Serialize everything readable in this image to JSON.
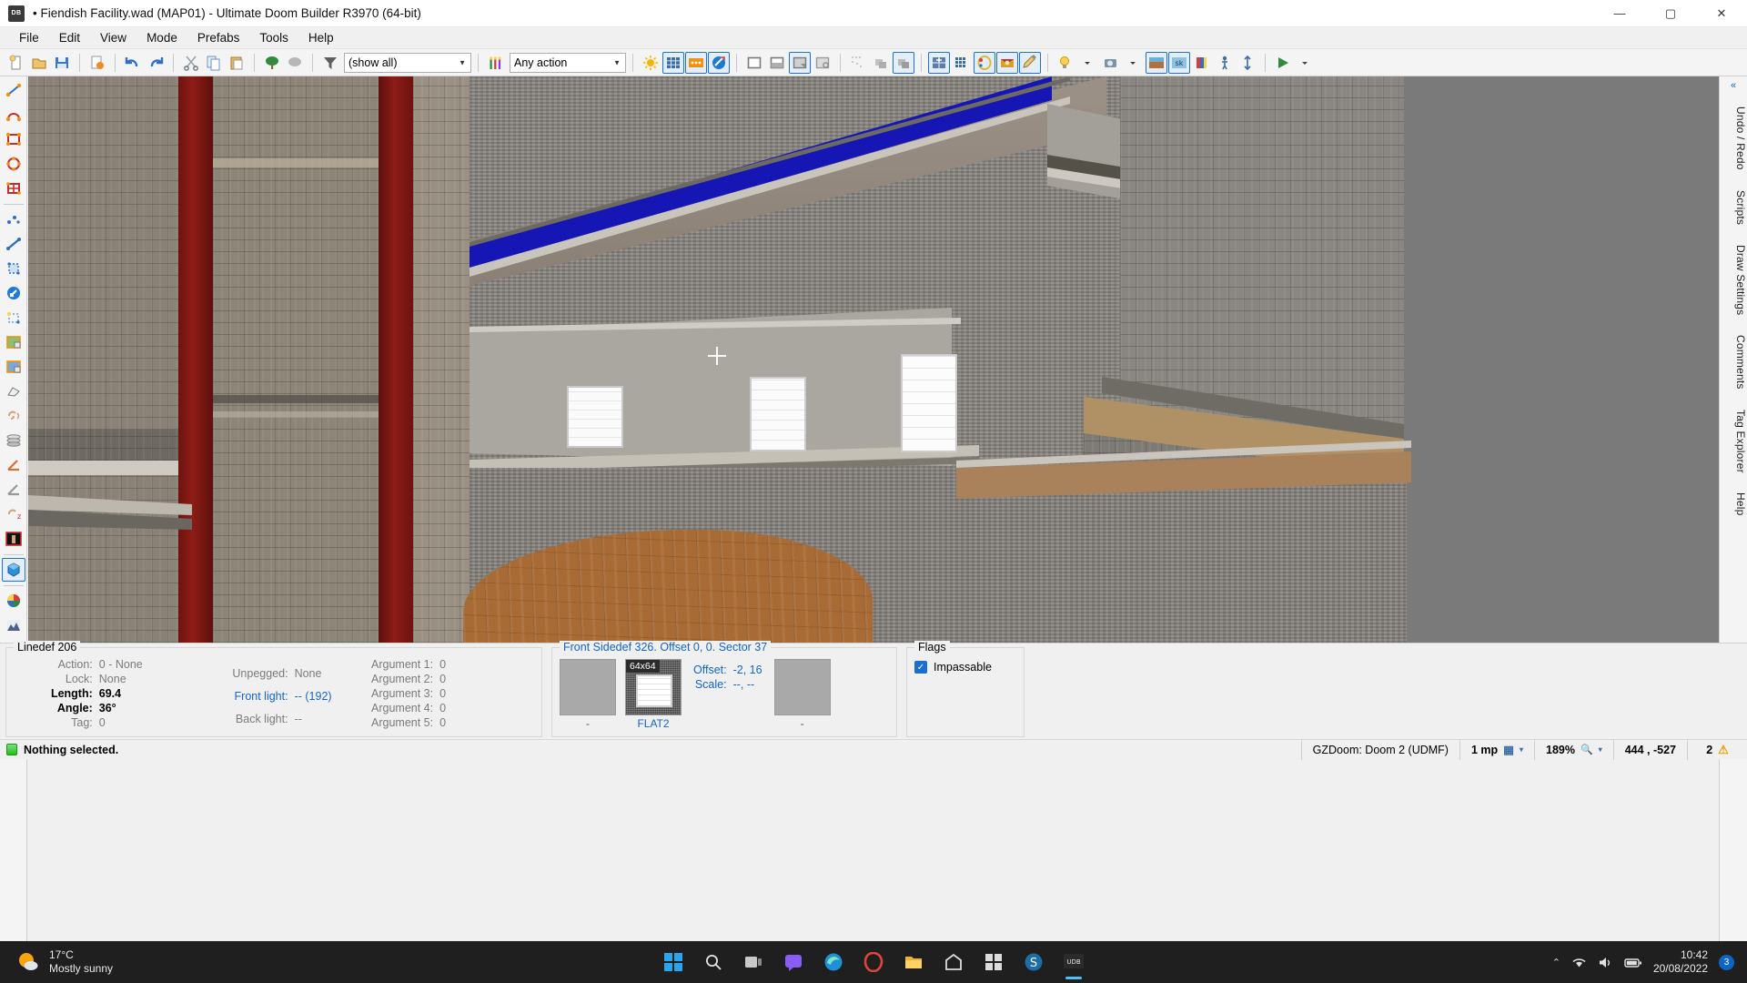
{
  "window": {
    "title": "• Fiendish Facility.wad (MAP01) - Ultimate Doom Builder R3970 (64-bit)",
    "app_badge": "DB",
    "minimize": "—",
    "maximize": "▢",
    "close": "✕"
  },
  "menu": {
    "items": [
      "File",
      "Edit",
      "View",
      "Mode",
      "Prefabs",
      "Tools",
      "Help"
    ]
  },
  "toolbar": {
    "file_buttons": [
      {
        "name": "new-map-icon",
        "glyph": "📄"
      },
      {
        "name": "open-map-icon",
        "glyph": "📂"
      },
      {
        "name": "save-map-icon",
        "glyph": "💾"
      }
    ],
    "map_options_icon": "🗺",
    "undo_icon": "↶",
    "redo_icon": "↷",
    "cut_icon": "✂",
    "copy_icon": "⎘",
    "paste_icon": "📋",
    "bush_icon": "🌳",
    "cloud_icon": "☁",
    "filter_icon": "▽",
    "filter_value": "(show all)",
    "action_icon": "🎚",
    "action_value": "Any action",
    "view_buttons": [
      {
        "name": "brightness-icon",
        "selected": false
      },
      {
        "name": "grid-view-icon",
        "selected": true
      },
      {
        "name": "things-view-icon",
        "selected": true
      },
      {
        "name": "texture-view-icon",
        "selected": true
      }
    ],
    "render_buttons": [
      {
        "name": "wireframe-icon",
        "selected": false
      },
      {
        "name": "brightness-render-icon",
        "selected": false
      },
      {
        "name": "textured-render-icon",
        "selected": true
      },
      {
        "name": "normal-render-icon",
        "selected": false
      }
    ],
    "align_buttons": [
      {
        "name": "snap-vertices-icon",
        "selected": false
      },
      {
        "name": "snap-lines-icon",
        "selected": false
      },
      {
        "name": "snap-sectors-icon",
        "selected": true
      }
    ],
    "grid_buttons": [
      {
        "name": "grid-setup-icon",
        "selected": true
      },
      {
        "name": "dynamic-grid-icon",
        "selected": false
      },
      {
        "name": "light-mode-icon",
        "selected": true
      },
      {
        "name": "thing-mode-icon",
        "selected": true
      },
      {
        "name": "paint-mode-icon",
        "selected": true
      }
    ],
    "extra_buttons": [
      {
        "name": "bulb-icon",
        "selected": false
      },
      {
        "name": "camera-icon",
        "selected": false
      },
      {
        "name": "figure-icon",
        "selected": false
      },
      {
        "name": "arrow-updown-icon",
        "selected": false
      }
    ],
    "run_icon": "▶"
  },
  "left_toolbar": {
    "groups": [
      [
        {
          "name": "draw-lines-tool",
          "selected": false
        },
        {
          "name": "draw-curve-tool",
          "selected": false
        },
        {
          "name": "draw-rectangle-tool",
          "selected": false
        },
        {
          "name": "draw-ellipse-tool",
          "selected": false
        },
        {
          "name": "draw-grid-tool",
          "selected": false
        }
      ],
      [
        {
          "name": "vertices-mode",
          "selected": false
        },
        {
          "name": "linedefs-mode",
          "selected": false
        },
        {
          "name": "sectors-mode",
          "selected": false
        },
        {
          "name": "things-mode",
          "selected": false
        },
        {
          "name": "edit-selection-mode",
          "selected": false
        },
        {
          "name": "make-sector-mode",
          "selected": false
        },
        {
          "name": "make-door-mode",
          "selected": false
        },
        {
          "name": "bridge-mode",
          "selected": false
        },
        {
          "name": "sound-propagation-mode",
          "selected": false
        },
        {
          "name": "sector-3d-floor-mode",
          "selected": false
        },
        {
          "name": "slope-mode",
          "selected": false
        },
        {
          "name": "flat-mode",
          "selected": false
        },
        {
          "name": "sound-environment-mode",
          "selected": false
        },
        {
          "name": "brightness-mode",
          "selected": false
        }
      ],
      [
        {
          "name": "visual-mode-3d",
          "selected": true
        }
      ],
      [
        {
          "name": "color-picker-tool",
          "selected": false
        },
        {
          "name": "terrain-tool",
          "selected": false
        },
        {
          "name": "thing-alignment-tool",
          "selected": false
        },
        {
          "name": "texture-align-tool",
          "selected": false
        },
        {
          "name": "sector-edit-tool",
          "selected": false
        }
      ]
    ]
  },
  "right_dock": {
    "collapse_icon": "«",
    "expand_icon": "▾",
    "tabs": [
      "Undo / Redo",
      "Scripts",
      "Draw Settings",
      "Comments",
      "Tag Explorer",
      "Help"
    ]
  },
  "linedef_panel": {
    "title": "Linedef 206",
    "left_rows": [
      {
        "key": "Action:",
        "value": "0 - None",
        "emph": false
      },
      {
        "key": "Lock:",
        "value": "None",
        "emph": false
      },
      {
        "key": "Length:",
        "value": "69.4",
        "emph": true
      },
      {
        "key": "Angle:",
        "value": "36°",
        "emph": true
      },
      {
        "key": "Tag:",
        "value": "0",
        "emph": false
      }
    ],
    "mid_rows": [
      {
        "key": "",
        "value": "",
        "style": "plain"
      },
      {
        "key": "",
        "value": "",
        "style": "plain"
      },
      {
        "key": "Unpegged:",
        "value": "None",
        "style": "plain"
      },
      {
        "key": "Front light:",
        "value": "-- (192)",
        "style": "blue"
      },
      {
        "key": "Back light:",
        "value": "--",
        "style": "plain"
      }
    ],
    "args": [
      {
        "key": "Argument 1:",
        "value": "0"
      },
      {
        "key": "Argument 2:",
        "value": "0"
      },
      {
        "key": "Argument 3:",
        "value": "0"
      },
      {
        "key": "Argument 4:",
        "value": "0"
      },
      {
        "key": "Argument 5:",
        "value": "0"
      }
    ]
  },
  "sidedef_panel": {
    "title": "Front Sidedef 326. Offset 0, 0. Sector 37",
    "upper_caption": "-",
    "middle_badge": "64x64",
    "middle_caption": "FLAT2",
    "lower_caption": "-",
    "fields": [
      {
        "key": "Offset:",
        "value": "-2, 16"
      },
      {
        "key": "Scale:",
        "value": "--, --"
      }
    ]
  },
  "flags_panel": {
    "title": "Flags",
    "checks": [
      {
        "label": "Impassable",
        "checked": true,
        "mark": "✓"
      }
    ]
  },
  "statusbar": {
    "message": "Nothing selected.",
    "config": "GZDoom: Doom 2 (UDMF)",
    "grid": "1 mp",
    "grid_icon": "▦",
    "zoom": "189%",
    "zoom_icon": "🔍",
    "coords": "444 , -527",
    "warnings": "2",
    "warning_icon": "⚠"
  },
  "taskbar": {
    "weather_temp": "17°C",
    "weather_desc": "Mostly sunny",
    "apps": [
      {
        "name": "start-button",
        "glyph": "⊞"
      },
      {
        "name": "search-button",
        "glyph": "🔍"
      },
      {
        "name": "task-view-button",
        "glyph": "▭"
      },
      {
        "name": "chat-button",
        "glyph": "💬"
      },
      {
        "name": "edge-button",
        "glyph": "🌐"
      },
      {
        "name": "firefox-button",
        "glyph": "🦊"
      },
      {
        "name": "file-explorer-button",
        "glyph": "📁"
      },
      {
        "name": "store-button",
        "glyph": "⌂"
      },
      {
        "name": "office-button",
        "glyph": "▩"
      },
      {
        "name": "slade-button",
        "glyph": "S"
      },
      {
        "name": "doom-builder-button",
        "glyph": "UDB"
      }
    ],
    "tray": {
      "chevron": "⌃",
      "wifi": "📶",
      "volume": "🔊",
      "battery": "🔋",
      "time": "10:42",
      "date": "20/08/2022",
      "badge": "3"
    }
  }
}
